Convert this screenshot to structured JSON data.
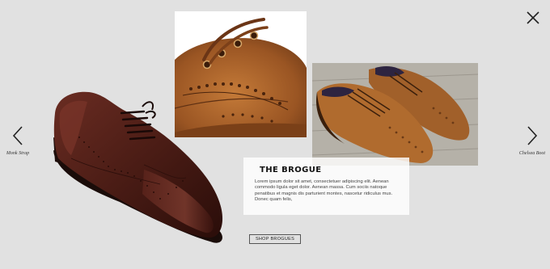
{
  "slide": {
    "title": "THE BROGUE",
    "description": "Lorem ipsum dolor sit amet, consectetuer adipiscing elit. Aenean commodo ligula eget dolor. Aenean massa. Cum sociis natoque penatibus et magnis dis parturient montes, nascetur ridiculus mus. Donec quam felis,",
    "cta_label": "SHOP BROGUES"
  },
  "nav": {
    "prev_label": "Monk Strap",
    "next_label": "Chelsea Boot"
  },
  "icons": {
    "close": "close-icon",
    "prev": "chevron-left-icon",
    "next": "chevron-right-icon"
  },
  "colors": {
    "background": "#e1e1e1",
    "shoe_dark": "#4a1f17",
    "shoe_tan": "#a8652a",
    "card": "#ffffff"
  }
}
